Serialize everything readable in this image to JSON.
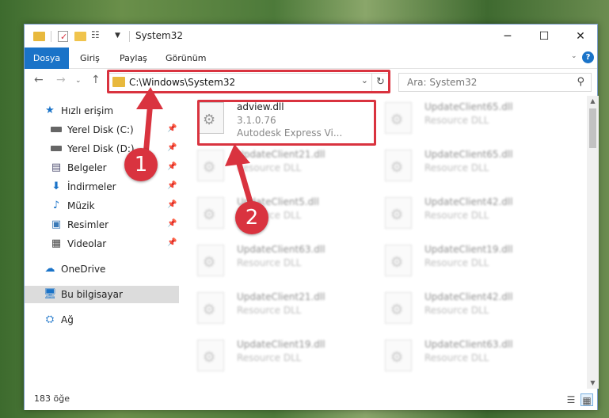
{
  "window": {
    "title": "System32"
  },
  "ribbon": {
    "tabs": [
      {
        "label": "Dosya"
      },
      {
        "label": "Giriş"
      },
      {
        "label": "Paylaş"
      },
      {
        "label": "Görünüm"
      }
    ],
    "help_label": "?"
  },
  "address": {
    "path": "C:\\Windows\\System32"
  },
  "search": {
    "placeholder": "Ara: System32"
  },
  "sidebar": {
    "items": [
      {
        "label": "Hızlı erişim",
        "icon": "star-icon"
      },
      {
        "label": "Yerel Disk (C:)",
        "icon": "drive-icon",
        "pinned": true
      },
      {
        "label": "Yerel Disk (D:)",
        "icon": "drive-icon",
        "pinned": true
      },
      {
        "label": "Belgeler",
        "icon": "documents-icon",
        "pinned": true
      },
      {
        "label": "İndirmeler",
        "icon": "download-icon",
        "pinned": true
      },
      {
        "label": "Müzik",
        "icon": "music-icon",
        "pinned": true
      },
      {
        "label": "Resimler",
        "icon": "pictures-icon",
        "pinned": true
      },
      {
        "label": "Videolar",
        "icon": "videos-icon",
        "pinned": true
      },
      {
        "label": "OneDrive",
        "icon": "cloud-icon"
      },
      {
        "label": "Bu bilgisayar",
        "icon": "computer-icon",
        "selected": true
      },
      {
        "label": "Ağ",
        "icon": "network-icon"
      }
    ]
  },
  "files": [
    {
      "name": "adview.dll",
      "line2": "3.1.0.76",
      "line3": "Autodesk Express Vi..."
    },
    {
      "name": "UpdateClient65.dll",
      "line2": "Resource DLL"
    },
    {
      "name": "UpdateClient21.dll",
      "line2": "Resource DLL"
    },
    {
      "name": "UpdateClient65.dll",
      "line2": "Resource DLL"
    },
    {
      "name": "UpdateClient5.dll",
      "line2": "Resource DLL"
    },
    {
      "name": "UpdateClient42.dll",
      "line2": "Resource DLL"
    },
    {
      "name": "UpdateClient63.dll",
      "line2": "Resource DLL"
    },
    {
      "name": "UpdateClient19.dll",
      "line2": "Resource DLL"
    },
    {
      "name": "UpdateClient21.dll",
      "line2": "Resource DLL"
    },
    {
      "name": "UpdateClient42.dll",
      "line2": "Resource DLL"
    },
    {
      "name": "UpdateClient19.dll",
      "line2": "Resource DLL"
    },
    {
      "name": "UpdateClient63.dll",
      "line2": "Resource DLL"
    }
  ],
  "status": {
    "item_count": "183 öğe"
  },
  "callouts": [
    {
      "label": "1"
    },
    {
      "label": "2"
    }
  ],
  "colors": {
    "accent": "#1a73c8",
    "highlight": "#d9333f"
  }
}
